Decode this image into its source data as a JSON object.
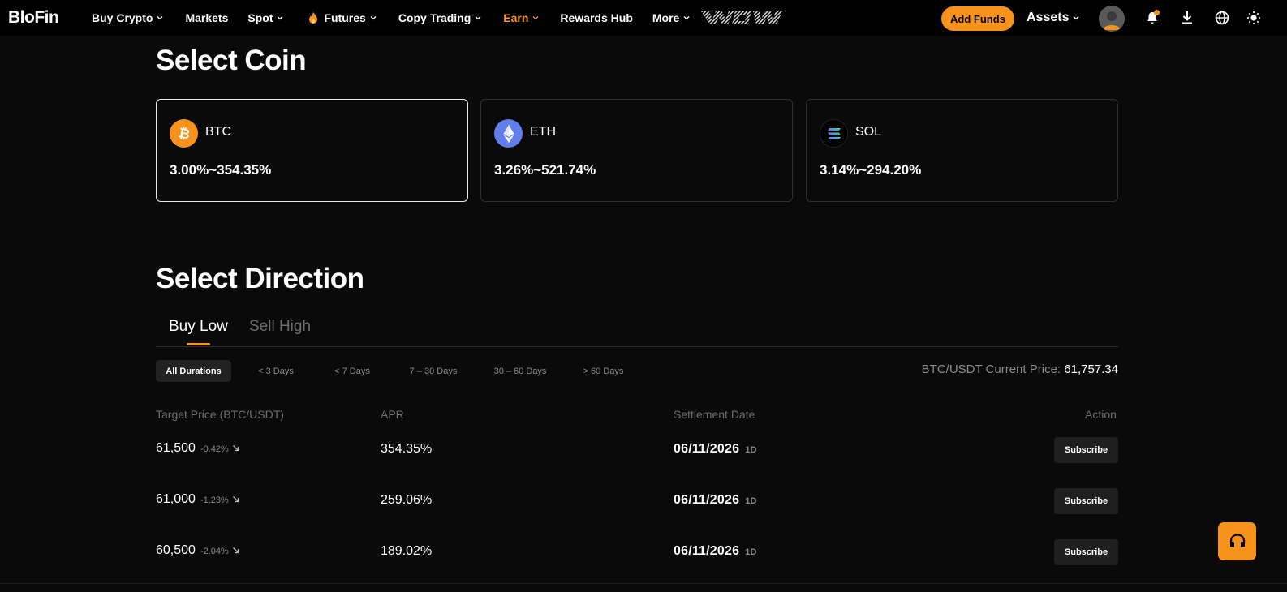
{
  "nav": {
    "logo": "BloFin",
    "items": [
      {
        "label": "Buy Crypto",
        "has_chevron": true
      },
      {
        "label": "Markets",
        "has_chevron": false
      },
      {
        "label": "Spot",
        "has_chevron": true
      },
      {
        "label": "Futures",
        "has_chevron": true,
        "icon": "flame-icon"
      },
      {
        "label": "Copy Trading",
        "has_chevron": true
      },
      {
        "label": "Earn",
        "has_chevron": true,
        "active": true
      },
      {
        "label": "Rewards Hub",
        "has_chevron": false
      },
      {
        "label": "More",
        "has_chevron": true
      }
    ],
    "promo_logo": "WOW",
    "add_funds": "Add Funds",
    "assets": "Assets",
    "accent_color": "#f7931a"
  },
  "select_coin": {
    "title": "Select Coin",
    "coins": [
      {
        "name": "BTC",
        "range": "3.00%~354.35%",
        "icon": "bitcoin-icon",
        "color": "#f7931a",
        "selected": true
      },
      {
        "name": "ETH",
        "range": "3.26%~521.74%",
        "icon": "ethereum-icon",
        "color": "#627eea",
        "selected": false
      },
      {
        "name": "SOL",
        "range": "3.14%~294.20%",
        "icon": "solana-icon",
        "color": "#000000",
        "selected": false
      }
    ]
  },
  "select_direction": {
    "title": "Select Direction",
    "tabs": [
      "Buy Low",
      "Sell High"
    ],
    "active_tab": "Buy Low"
  },
  "durations": [
    "All Durations",
    "< 3 Days",
    "< 7 Days",
    "7 – 30 Days",
    "30 – 60 Days",
    "> 60 Days"
  ],
  "current_price": {
    "label": "BTC/USDT Current Price:",
    "value": "61,757.34"
  },
  "table": {
    "headers": {
      "target": "Target Price (BTC/USDT)",
      "apr": "APR",
      "settlement": "Settlement Date",
      "action": "Action"
    },
    "rows": [
      {
        "target": "61,500",
        "change": "-0.42%",
        "apr": "354.35%",
        "date": "06/11/2026",
        "term": "1D",
        "action": "Subscribe"
      },
      {
        "target": "61,000",
        "change": "-1.23%",
        "apr": "259.06%",
        "date": "06/11/2026",
        "term": "1D",
        "action": "Subscribe"
      },
      {
        "target": "60,500",
        "change": "-2.04%",
        "apr": "189.02%",
        "date": "06/11/2026",
        "term": "1D",
        "action": "Subscribe"
      }
    ]
  }
}
